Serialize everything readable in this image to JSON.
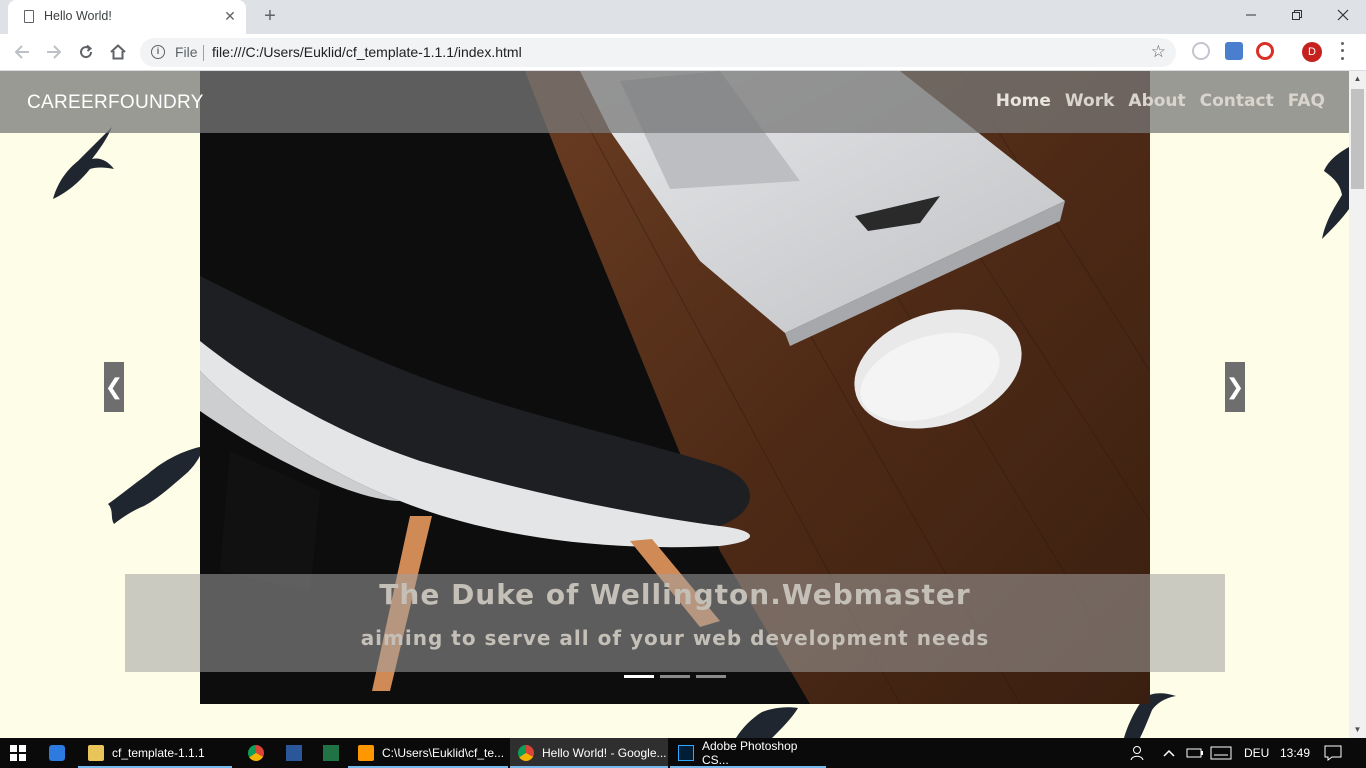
{
  "browser": {
    "tab_title": "Hello World!",
    "close_glyph": "✕",
    "new_tab_glyph": "+",
    "scheme_label": "File",
    "url": "file:///C:/Users/Euklid/cf_template-1.1.1/index.html",
    "profile_initial": "D"
  },
  "site": {
    "brand": "CAREERFOUNDRY",
    "nav": [
      {
        "label": "Home"
      },
      {
        "label": "Work"
      },
      {
        "label": "About"
      },
      {
        "label": "Contact"
      },
      {
        "label": "FAQ"
      }
    ],
    "carousel": {
      "prev_glyph": "❮",
      "next_glyph": "❯",
      "caption_title": "The Duke of Wellington.Webmaster",
      "caption_subtitle": "aiming to serve all of your web development needs",
      "slides": 3,
      "active_slide": 1
    }
  },
  "taskbar": {
    "items": [
      {
        "label": "cf_template-1.1.1",
        "icon": "folder-icon"
      },
      {
        "label": "",
        "icon": "chrome-icon"
      },
      {
        "label": "",
        "icon": "word-icon"
      },
      {
        "label": "",
        "icon": "excel-icon"
      },
      {
        "label": "C:\\Users\\Euklid\\cf_te...",
        "icon": "sublime-icon"
      },
      {
        "label": "Hello World! - Google...",
        "icon": "chrome-icon"
      },
      {
        "label": "Adobe Photoshop CS...",
        "icon": "photoshop-icon"
      }
    ],
    "language": "DEU",
    "time": "13:49"
  },
  "colors": {
    "page_background": "#fefde8",
    "navbar": "#787878",
    "taskbar": "#0a0a0a",
    "profile": "#c5221f"
  }
}
